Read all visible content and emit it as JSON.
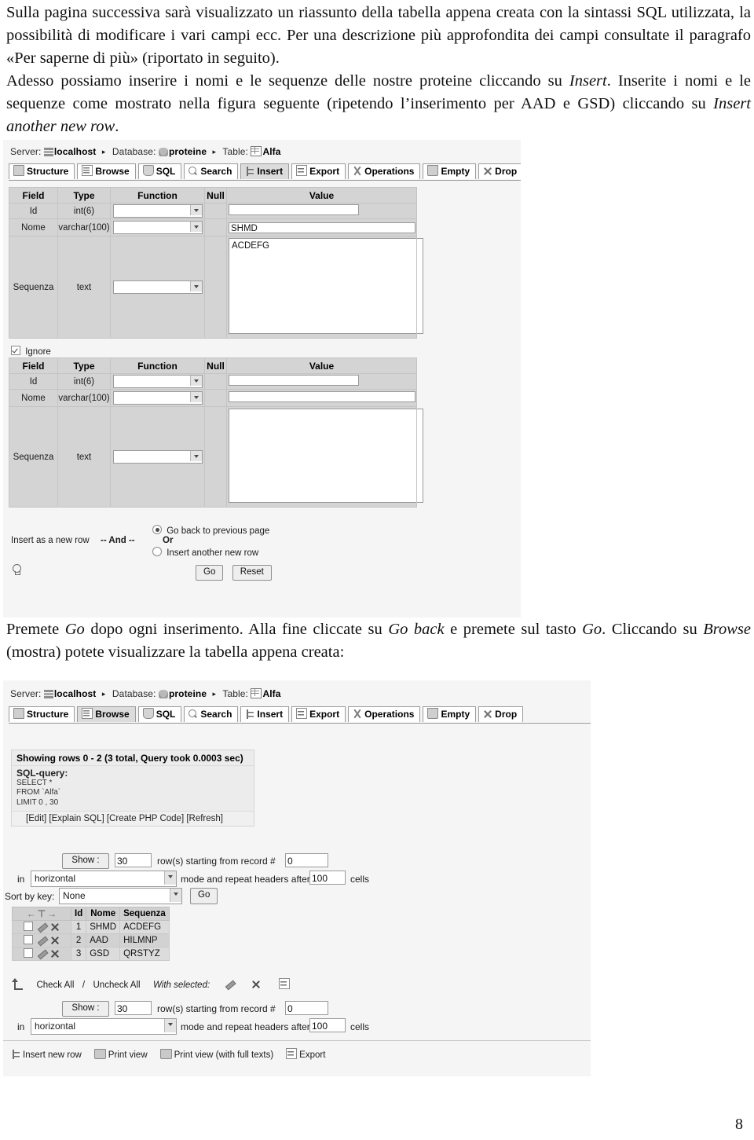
{
  "document": {
    "page_number": "8",
    "paragraph_top_html": "Sulla pagina successiva sarà visualizzato un riassunto della tabella appena creata con la sintassi SQL utilizzata, la possibilità di modificare i vari campi ecc. Per una descrizione più approfondita dei campi consultate il paragrafo «Per saperne di più» (riportato in seguito).<br>Adesso possiamo inserire i nomi e le sequenze delle nostre proteine cliccando su <i>Insert</i>. Inserite i nomi e le sequenze come mostrato nella figura seguente (ripetendo l’inserimento per AAD e GSD) cliccando su <i>Insert another new row</i>.",
    "paragraph_mid_html": "Premete <i>Go</i> dopo ogni inserimento. Alla fine cliccate su <i>Go back</i> e premete sul tasto <i>Go</i>. Cliccando su <i>Browse</i> (mostra) potete visualizzare la tabella appena creata:"
  },
  "insert_screen": {
    "breadcrumb": {
      "server_label": "Server:",
      "server_value": "localhost",
      "database_label": "Database:",
      "database_value": "proteine",
      "table_label": "Table:",
      "table_value": "Alfa",
      "separator": "▸"
    },
    "tabs": [
      {
        "label": "Structure",
        "icon": "structure-icon",
        "active": false
      },
      {
        "label": "Browse",
        "icon": "browse-icon",
        "active": false
      },
      {
        "label": "SQL",
        "icon": "sql-icon",
        "active": false
      },
      {
        "label": "Search",
        "icon": "search-icon",
        "active": false
      },
      {
        "label": "Insert",
        "icon": "insert-icon",
        "active": true
      },
      {
        "label": "Export",
        "icon": "export-icon",
        "active": false
      },
      {
        "label": "Operations",
        "icon": "operations-icon",
        "active": false
      },
      {
        "label": "Empty",
        "icon": "empty-icon",
        "active": false
      },
      {
        "label": "Drop",
        "icon": "drop-icon",
        "active": false
      }
    ],
    "columns": [
      "Field",
      "Type",
      "Function",
      "Null",
      "Value"
    ],
    "row1": {
      "id": {
        "field": "Id",
        "type": "int(6)",
        "function": "",
        "value": ""
      },
      "nome": {
        "field": "Nome",
        "type": "varchar(100)",
        "function": "",
        "value": "SHMD"
      },
      "sequenza": {
        "field": "Sequenza",
        "type": "text",
        "function": "",
        "value": "ACDEFG"
      }
    },
    "ignore_label": "Ignore",
    "ignore_checked": true,
    "row2": {
      "id": {
        "field": "Id",
        "type": "int(6)",
        "function": "",
        "value": ""
      },
      "nome": {
        "field": "Nome",
        "type": "varchar(100)",
        "function": "",
        "value": ""
      },
      "sequenza": {
        "field": "Sequenza",
        "type": "text",
        "function": "",
        "value": ""
      }
    },
    "footer": {
      "insert_as_label": "Insert as a new row",
      "and_label": "-- And --",
      "radio_back_label": "Go back to previous page",
      "or_label": "Or",
      "radio_another_label": "Insert another new row",
      "radio_back_selected": true,
      "go_label": "Go",
      "reset_label": "Reset"
    }
  },
  "browse_screen": {
    "breadcrumb": {
      "server_label": "Server:",
      "server_value": "localhost",
      "database_label": "Database:",
      "database_value": "proteine",
      "table_label": "Table:",
      "table_value": "Alfa",
      "separator": "▸"
    },
    "tabs": [
      {
        "label": "Structure",
        "icon": "structure-icon",
        "active": false
      },
      {
        "label": "Browse",
        "icon": "browse-icon",
        "active": true
      },
      {
        "label": "SQL",
        "icon": "sql-icon",
        "active": false
      },
      {
        "label": "Search",
        "icon": "search-icon",
        "active": false
      },
      {
        "label": "Insert",
        "icon": "insert-icon",
        "active": false
      },
      {
        "label": "Export",
        "icon": "export-icon",
        "active": false
      },
      {
        "label": "Operations",
        "icon": "operations-icon",
        "active": false
      },
      {
        "label": "Empty",
        "icon": "empty-icon",
        "active": false
      },
      {
        "label": "Drop",
        "icon": "drop-icon",
        "active": false
      }
    ],
    "showing_rows": "Showing rows 0 - 2 (3 total, Query took 0.0003 sec)",
    "sql_query_title": "SQL-query:",
    "sql_line1": "SELECT *",
    "sql_line2": "FROM `Alfa`",
    "sql_line3": "LIMIT 0 , 30",
    "action_links": "[Edit] [Explain SQL] [Create PHP Code] [Refresh]",
    "nav_top": {
      "show_button": "Show :",
      "rows_value": "30",
      "rows_label": "row(s) starting from record #",
      "record_value": "0",
      "in_label": "in",
      "mode_value": "horizontal",
      "mode_label": "mode and repeat headers after",
      "headers_value": "100",
      "cells_label": "cells",
      "sort_label": "Sort by key:",
      "sort_value": "None",
      "go_label": "Go"
    },
    "table": {
      "headers": [
        "Id",
        "Nome",
        "Sequenza"
      ],
      "rows": [
        {
          "id": "1",
          "nome": "SHMD",
          "sequenza": "ACDEFG"
        },
        {
          "id": "2",
          "nome": "AAD",
          "sequenza": "HILMNP"
        },
        {
          "id": "3",
          "nome": "GSD",
          "sequenza": "QRSTYZ"
        }
      ]
    },
    "check_all_label": "Check All",
    "slash_label": "/",
    "uncheck_all_label": "Uncheck All",
    "with_selected_label": "With selected:",
    "nav_bottom": {
      "show_button": "Show :",
      "rows_value": "30",
      "rows_label": "row(s) starting from record #",
      "record_value": "0",
      "in_label": "in",
      "mode_value": "horizontal",
      "mode_label": "mode and repeat headers after",
      "headers_value": "100",
      "cells_label": "cells"
    },
    "footer_links": [
      {
        "label": "Insert new row",
        "icon": "insert-icon"
      },
      {
        "label": "Print view",
        "icon": "printer-icon"
      },
      {
        "label": "Print view (with full texts)",
        "icon": "printer-icon"
      },
      {
        "label": "Export",
        "icon": "export-icon"
      }
    ]
  }
}
